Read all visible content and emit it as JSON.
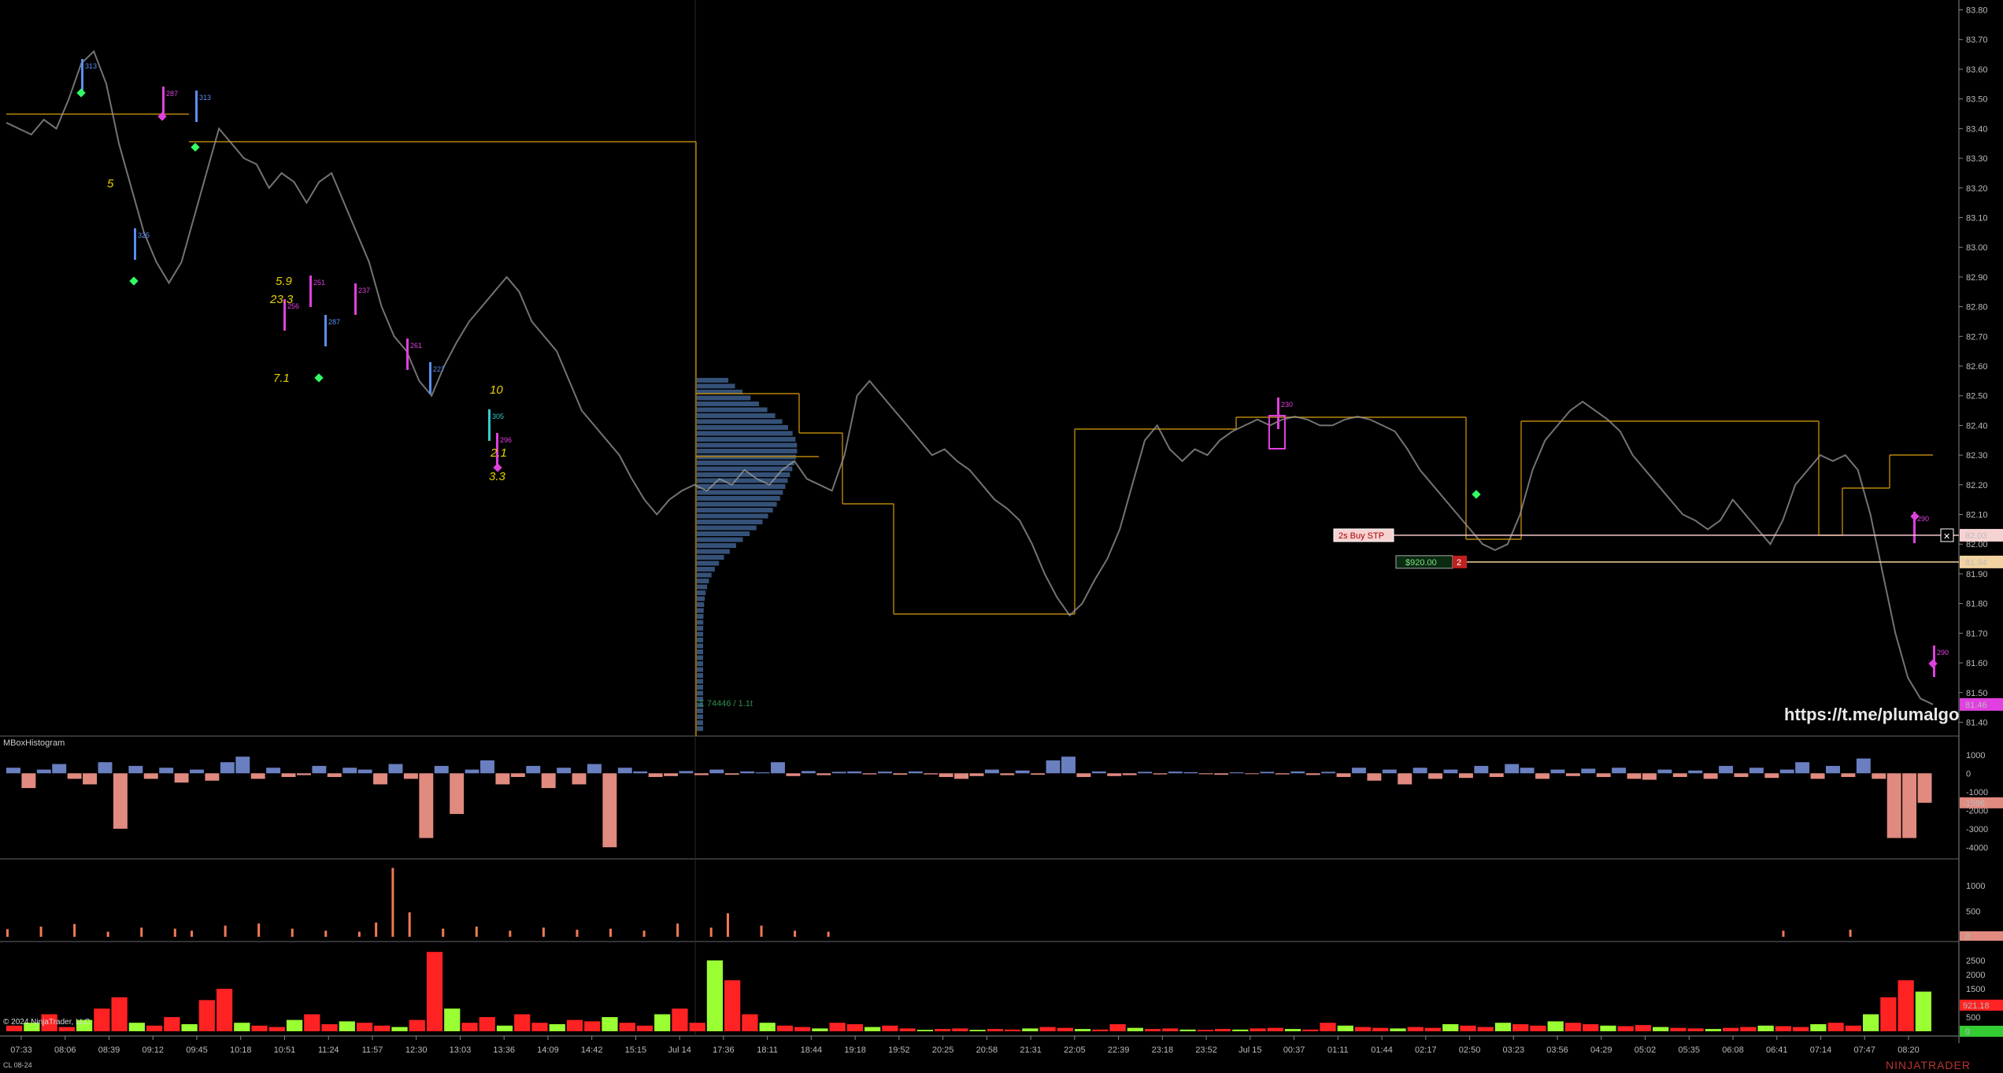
{
  "main": {
    "url_text": "https://t.me/plumalgo",
    "profile_label": "Σ 74446 / 1.1t",
    "order": {
      "label": "2s Buy STP",
      "pnl": "$920.00",
      "qty": "2"
    },
    "annotations": [
      "5",
      "5.9",
      "23.3",
      "7.1",
      "10",
      "2.1",
      "3.3"
    ],
    "signal_labels": [
      "313",
      "325",
      "287",
      "313",
      "256",
      "251",
      "287",
      "237",
      "261",
      "227",
      "305",
      "296",
      "230",
      "290",
      "290"
    ]
  },
  "indicator_panel": {
    "title": "MBoxHistogram"
  },
  "footer": {
    "copyright": "© 2024 NinjaTrader, LLC",
    "instrument": "CL 08-24",
    "brand": "NINJATRADER"
  },
  "colors": {
    "background": "#000000",
    "price": "#9a9a9a",
    "gold": "#b8860b",
    "magenta": "#e040e0",
    "blue": "#5b8ff0",
    "green": "#33ff66",
    "histo_pos": "#6a7fc0",
    "histo_neg": "#e08a80",
    "vol_green": "#9aff33",
    "vol_red": "#ff2222"
  },
  "chart_data": [
    {
      "type": "line",
      "name": "price",
      "x_ticks": [
        "07:33",
        "08:06",
        "08:39",
        "09:12",
        "09:45",
        "10:18",
        "10:51",
        "11:24",
        "11:57",
        "12:30",
        "13:03",
        "13:36",
        "14:09",
        "14:42",
        "15:15",
        "Jul 14",
        "17:36",
        "18:11",
        "18:44",
        "19:18",
        "19:52",
        "20:25",
        "20:58",
        "21:31",
        "22:05",
        "22:39",
        "23:18",
        "23:52",
        "Jul 15",
        "00:37",
        "01:11",
        "01:44",
        "02:17",
        "02:50",
        "03:23",
        "03:56",
        "04:29",
        "05:02",
        "05:35",
        "06:08",
        "06:41",
        "07:14",
        "07:47",
        "08:20"
      ],
      "y_ticks": [
        "83.80",
        "83.70",
        "83.60",
        "83.50",
        "83.40",
        "83.30",
        "83.20",
        "83.10",
        "83.00",
        "82.90",
        "82.80",
        "82.70",
        "82.60",
        "82.50",
        "82.40",
        "82.30",
        "82.20",
        "82.10",
        "82.00",
        "81.90",
        "81.80",
        "81.70",
        "81.60",
        "81.50",
        "81.40"
      ],
      "ylim": [
        81.38,
        83.82
      ],
      "price_labels": {
        "buy_stop": "82.03",
        "entry": "81.94",
        "last": "81.46"
      },
      "y": [
        83.42,
        83.4,
        83.38,
        83.43,
        83.4,
        83.5,
        83.62,
        83.66,
        83.55,
        83.35,
        83.2,
        83.05,
        82.95,
        82.88,
        82.95,
        83.1,
        83.25,
        83.4,
        83.35,
        83.3,
        83.28,
        83.2,
        83.25,
        83.22,
        83.15,
        83.22,
        83.25,
        83.15,
        83.05,
        82.95,
        82.8,
        82.7,
        82.65,
        82.55,
        82.5,
        82.6,
        82.68,
        82.75,
        82.8,
        82.85,
        82.9,
        82.85,
        82.75,
        82.7,
        82.65,
        82.55,
        82.45,
        82.4,
        82.35,
        82.3,
        82.22,
        82.15,
        82.1,
        82.15,
        82.18,
        82.2,
        82.18,
        82.22,
        82.2,
        82.25,
        82.22,
        82.2,
        82.25,
        82.28,
        82.22,
        82.2,
        82.18,
        82.3,
        82.5,
        82.55,
        82.5,
        82.45,
        82.4,
        82.35,
        82.3,
        82.32,
        82.28,
        82.25,
        82.2,
        82.15,
        82.12,
        82.08,
        82.0,
        81.9,
        81.82,
        81.76,
        81.8,
        81.88,
        81.95,
        82.05,
        82.2,
        82.35,
        82.4,
        82.32,
        82.28,
        82.32,
        82.3,
        82.35,
        82.38,
        82.4,
        82.42,
        82.4,
        82.42,
        82.43,
        82.42,
        82.4,
        82.4,
        82.42,
        82.43,
        82.42,
        82.4,
        82.38,
        82.32,
        82.25,
        82.2,
        82.15,
        82.1,
        82.05,
        82.0,
        81.98,
        82.0,
        82.1,
        82.25,
        82.35,
        82.4,
        82.45,
        82.48,
        82.45,
        82.42,
        82.38,
        82.3,
        82.25,
        82.2,
        82.15,
        82.1,
        82.08,
        82.05,
        82.08,
        82.15,
        82.1,
        82.05,
        82.0,
        82.08,
        82.2,
        82.25,
        82.3,
        82.28,
        82.3,
        82.25,
        82.1,
        81.9,
        81.7,
        81.55,
        81.48,
        81.46
      ]
    },
    {
      "type": "bar",
      "name": "MBoxHistogram",
      "y_ticks": [
        "1000",
        "0",
        "-1000",
        "-2000",
        "-3000",
        "-4000"
      ],
      "ylim": [
        -4500,
        1800
      ],
      "last_value": "-1596",
      "values": [
        300,
        -800,
        200,
        500,
        -300,
        -600,
        600,
        -3000,
        400,
        -300,
        300,
        -500,
        200,
        -400,
        600,
        900,
        -300,
        300,
        -200,
        -100,
        400,
        -200,
        300,
        200,
        -600,
        500,
        -300,
        -3500,
        400,
        -2200,
        200,
        700,
        -600,
        -200,
        400,
        -800,
        300,
        -600,
        500,
        -4000,
        300,
        100,
        -200,
        -150,
        120,
        -100,
        200,
        -80,
        100,
        50,
        600,
        -150,
        120,
        -100,
        80,
        100,
        -60,
        90,
        -80,
        100,
        -60,
        -200,
        -300,
        -150,
        200,
        -100,
        150,
        -80,
        700,
        900,
        -200,
        100,
        -150,
        -100,
        80,
        -60,
        90,
        60,
        -50,
        -80,
        50,
        -40,
        80,
        -60,
        100,
        -90,
        80,
        -200,
        300,
        -400,
        200,
        -600,
        300,
        -300,
        200,
        -250,
        400,
        -200,
        500,
        300,
        -300,
        200,
        -150,
        250,
        -200,
        300,
        -300,
        -350,
        200,
        -200,
        150,
        -300,
        400,
        -200,
        300,
        -250,
        200,
        600,
        -300,
        400,
        -200,
        800,
        -300,
        -3500,
        -3500,
        -1596
      ]
    },
    {
      "type": "bar",
      "name": "volume_spikes",
      "y_ticks": [
        "1000",
        "500",
        "0"
      ],
      "ylim": [
        0,
        1450
      ],
      "last_value": "0",
      "values": [
        150,
        0,
        200,
        0,
        250,
        0,
        100,
        0,
        180,
        0,
        160,
        120,
        0,
        220,
        0,
        260,
        0,
        160,
        0,
        120,
        0,
        100,
        280,
        1350,
        480,
        0,
        160,
        0,
        200,
        0,
        120,
        0,
        180,
        0,
        140,
        0,
        160,
        0,
        120,
        0,
        260,
        0,
        180,
        460,
        0,
        220,
        0,
        120,
        0,
        100,
        0,
        0,
        0,
        0,
        0,
        0,
        0,
        0,
        0,
        0,
        0,
        0,
        0,
        0,
        0,
        0,
        0,
        0,
        0,
        0,
        0,
        0,
        0,
        0,
        0,
        0,
        0,
        0,
        0,
        0,
        0,
        0,
        0,
        0,
        0,
        0,
        0,
        0,
        0,
        0,
        0,
        0,
        0,
        0,
        0,
        0,
        0,
        0,
        0,
        0,
        0,
        0,
        0,
        0,
        0,
        0,
        120,
        0,
        0,
        0,
        140,
        0,
        0,
        0,
        0
      ]
    },
    {
      "type": "bar",
      "name": "delta_volume",
      "y_ticks": [
        "2500",
        "2000",
        "1500",
        "1000",
        "500",
        "0"
      ],
      "ylim": [
        0,
        3000
      ],
      "last_value": "921.18",
      "values": [
        200,
        300,
        600,
        150,
        400,
        800,
        1200,
        300,
        200,
        500,
        250,
        1100,
        1500,
        300,
        200,
        150,
        400,
        600,
        250,
        350,
        300,
        200,
        150,
        400,
        2800,
        800,
        300,
        500,
        200,
        600,
        300,
        250,
        400,
        350,
        500,
        300,
        200,
        600,
        800,
        300,
        2500,
        1800,
        600,
        300,
        200,
        150,
        100,
        300,
        250,
        150,
        200,
        100,
        50,
        80,
        100,
        50,
        80,
        60,
        100,
        150,
        120,
        80,
        60,
        250,
        120,
        80,
        100,
        60,
        50,
        80,
        60,
        100,
        120,
        80,
        60,
        300,
        200,
        150,
        120,
        100,
        150,
        120,
        250,
        200,
        150,
        300,
        250,
        200,
        350,
        300,
        250,
        200,
        180,
        220,
        150,
        120,
        100,
        80,
        120,
        150,
        200,
        180,
        150,
        250,
        300,
        200,
        600,
        1200,
        1800,
        1400
      ]
    }
  ]
}
